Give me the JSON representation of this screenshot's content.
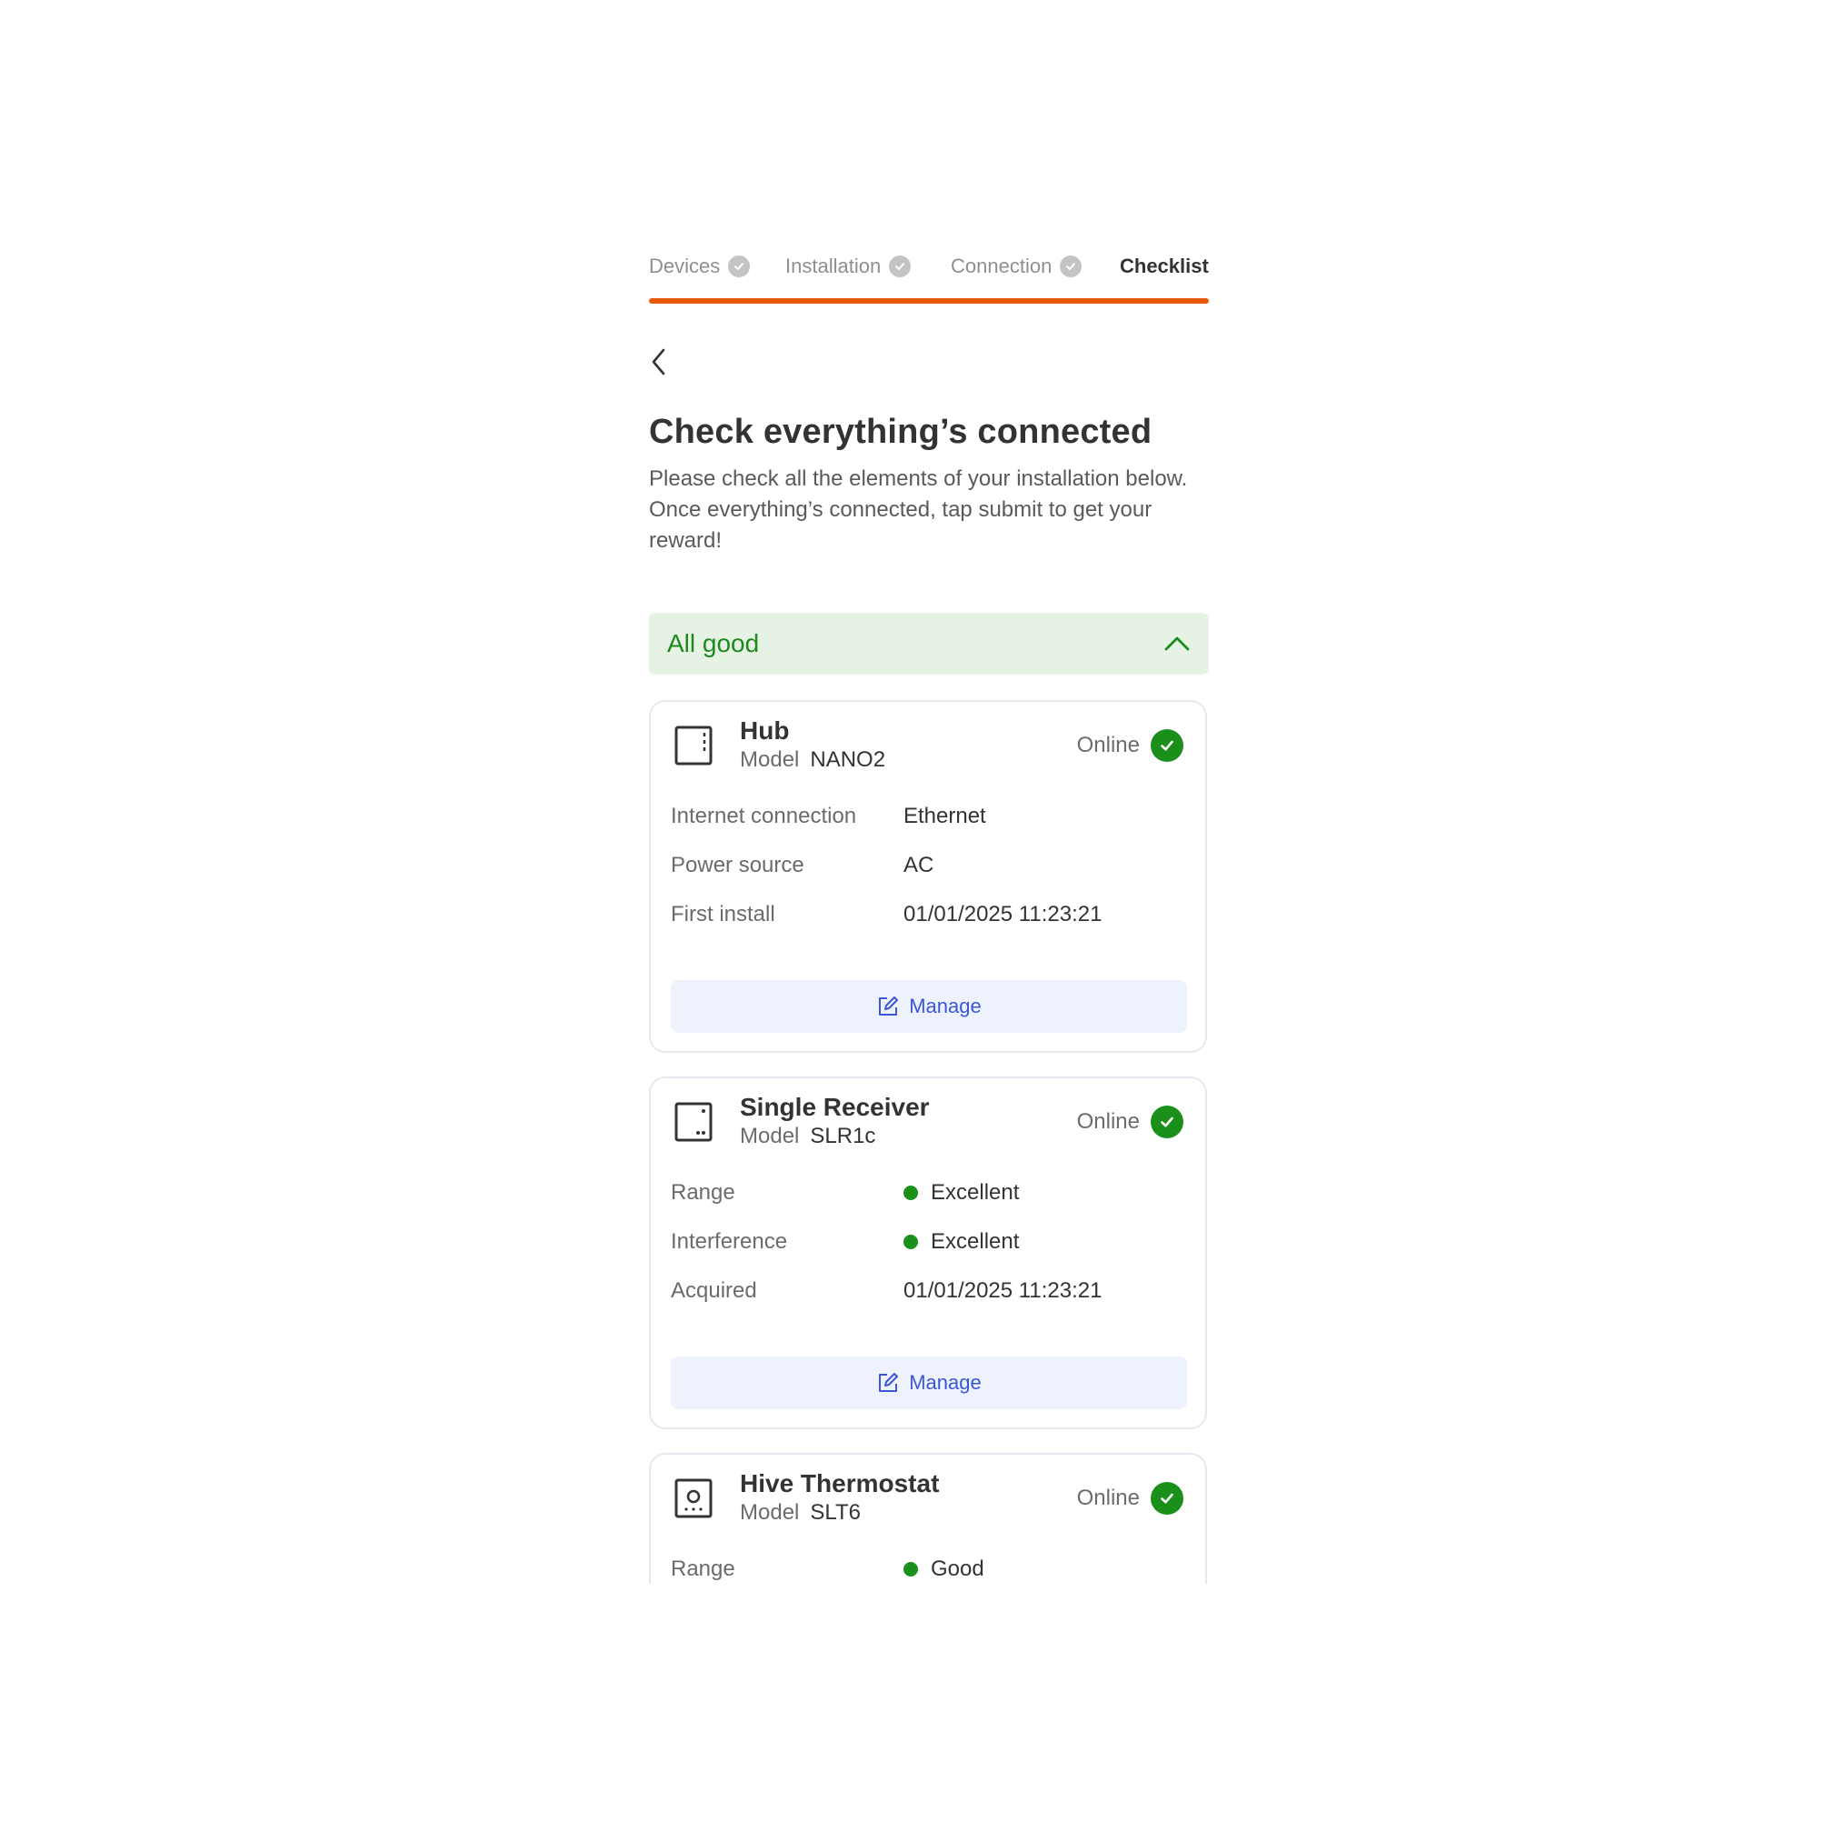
{
  "stepper": {
    "steps": [
      {
        "label": "Devices",
        "state": "done"
      },
      {
        "label": "Installation",
        "state": "done"
      },
      {
        "label": "Connection",
        "state": "done"
      },
      {
        "label": "Checklist",
        "state": "current"
      }
    ],
    "accent_color": "#e8590c"
  },
  "header": {
    "title": "Check everything’s connected",
    "description": "Please check all the elements of your installation below. Once everything’s connected, tap submit to get your reward!"
  },
  "status_banner": {
    "label": "All good",
    "color": "#1e8a1e",
    "icon": "chevron-up-icon"
  },
  "devices": [
    {
      "name": "Hub",
      "model_label": "Model",
      "model": "NANO2",
      "status": "Online",
      "icon": "hub-icon",
      "details": [
        {
          "key": "Internet connection",
          "value": "Ethernet"
        },
        {
          "key": "Power source",
          "value": "AC"
        },
        {
          "key": "First install",
          "value": "01/01/2025 11:23:21"
        }
      ],
      "manage_label": "Manage"
    },
    {
      "name": "Single Receiver",
      "model_label": "Model",
      "model": "SLR1c",
      "status": "Online",
      "icon": "receiver-icon",
      "details": [
        {
          "key": "Range",
          "value": "Excellent"
        },
        {
          "key": "Interference",
          "value": "Excellent"
        },
        {
          "key": "Acquired",
          "value": "01/01/2025 11:23:21"
        }
      ],
      "manage_label": "Manage"
    },
    {
      "name": "Hive Thermostat",
      "model_label": "Model",
      "model": "SLT6",
      "status": "Online",
      "icon": "thermostat-icon",
      "details": [
        {
          "key": "Range",
          "value": "Good"
        }
      ]
    }
  ],
  "colors": {
    "online_green": "#1a8f1a",
    "manage_blue": "#3b57d6"
  }
}
